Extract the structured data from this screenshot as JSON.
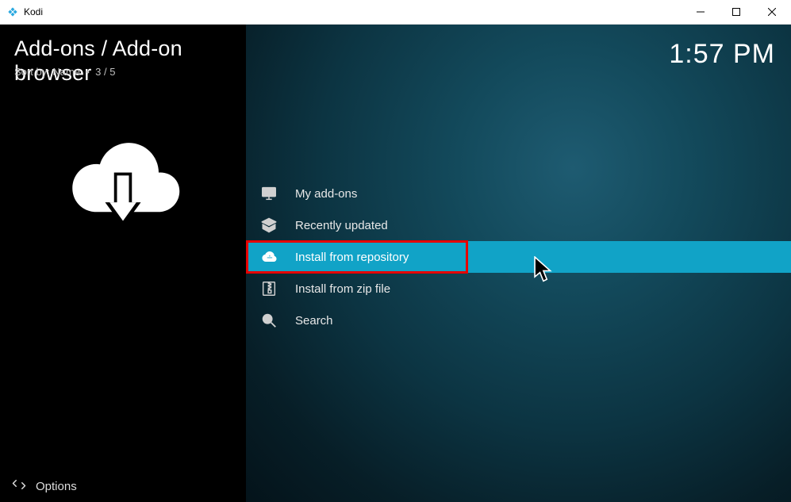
{
  "window": {
    "title": "Kodi"
  },
  "header": {
    "breadcrumb": "Add-ons / Add-on browser",
    "sort_label": "Sort by:",
    "sort_value": "Name",
    "position": "3 / 5",
    "clock": "1:57 PM"
  },
  "menu": {
    "items": [
      {
        "label": "My add-ons",
        "icon": "monitor-icon"
      },
      {
        "label": "Recently updated",
        "icon": "box-icon"
      },
      {
        "label": "Install from repository",
        "icon": "cloud-plus-icon",
        "selected": true
      },
      {
        "label": "Install from zip file",
        "icon": "zip-icon"
      },
      {
        "label": "Search",
        "icon": "search-icon"
      }
    ]
  },
  "footer": {
    "options": "Options"
  }
}
